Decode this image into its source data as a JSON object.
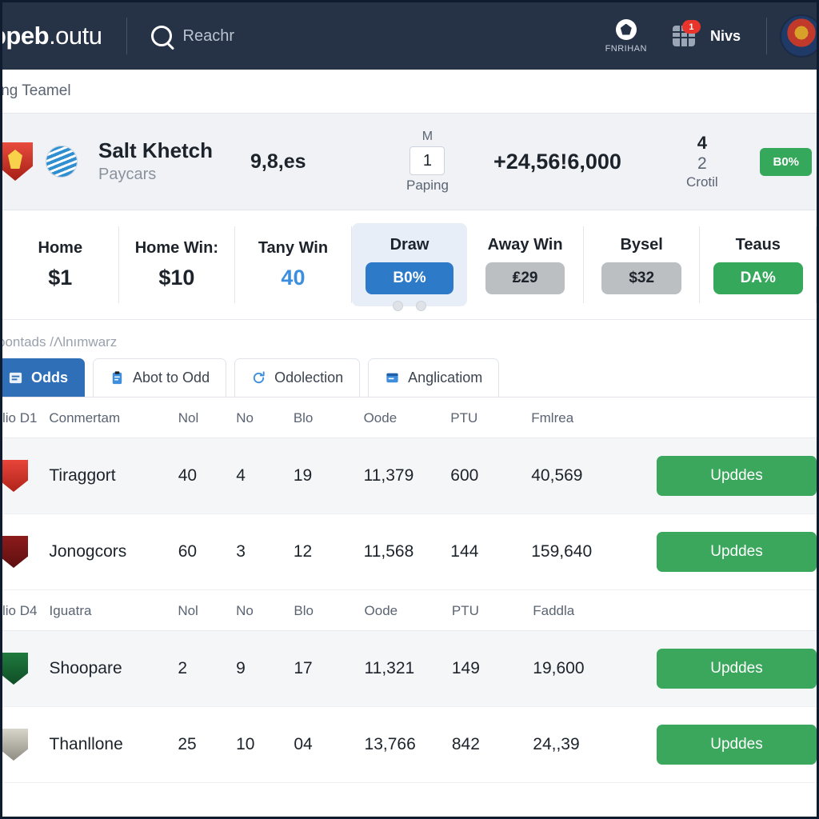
{
  "topnav": {
    "brand_bold": "ppeb",
    "brand_light": ".outu",
    "search_placeholder": "Reachr",
    "search_icon": "search-icon",
    "ball_icon": "soccer-ball-icon",
    "ball_label": "FNRIHAN",
    "grid_icon": "grid-icon",
    "grid_badge": "1",
    "notifications_label": "Nivs",
    "avatar": "user-avatar"
  },
  "breadcrumb": {
    "text": "ing Teamel"
  },
  "match_header": {
    "crest_icon": "team-crest-icon",
    "globe_icon": "globe-icon",
    "team_name": "Salt Khetch",
    "team_sub": "Paycars",
    "score": "9,8,es",
    "group_top": "M",
    "group_box": "1",
    "group_bottom": "Paping",
    "big_value": "+24,56!6,000",
    "stack_top": "4",
    "stack_mid": "2",
    "stack_bottom": "Crotil",
    "badge": "B0%",
    "badge_color": "#35a85b"
  },
  "odds": {
    "cells": [
      {
        "label": "Home",
        "value": "$1",
        "style": "text"
      },
      {
        "label": "Home Win:",
        "value": "$10",
        "style": "text"
      },
      {
        "label": "Tany Win",
        "value": "40",
        "style": "text-blue"
      },
      {
        "label": "Draw",
        "value": "B0%",
        "style": "pill-blue"
      },
      {
        "label": "Away Win",
        "value": "₤29",
        "style": "pill-gray"
      },
      {
        "label": "Bysel",
        "value": "$32",
        "style": "pill-gray"
      },
      {
        "label": "Teaus",
        "value": "DA%",
        "style": "pill-green"
      }
    ],
    "dots": 2,
    "accent_blue": "#2d7bc8",
    "accent_green": "#35a85b"
  },
  "section": {
    "label": "pontads /Λlnımwarz"
  },
  "tabs": [
    {
      "label": "Odds",
      "icon": "odds-icon",
      "active": true
    },
    {
      "label": "Abot to Odd",
      "icon": "clipboard-icon",
      "active": false
    },
    {
      "label": "Odolection",
      "icon": "refresh-icon",
      "active": false
    },
    {
      "label": "Anglicatiom",
      "icon": "window-icon",
      "active": false
    }
  ],
  "table": {
    "group1": {
      "headers": [
        "lio D1",
        "Conmertam",
        "Nol",
        "No",
        "Blo",
        "Oode",
        "PTU",
        "Fmlrea",
        ""
      ],
      "rows": [
        {
          "crest": "crest-red",
          "name": "Tiraggort",
          "c1": "40",
          "c2": "4",
          "c3": "19",
          "c4": "11,379",
          "c5": "600",
          "c6": "40,569",
          "action": "Upddes"
        },
        {
          "crest": "crest-maroon",
          "name": "Jonogcors",
          "c1": "60",
          "c2": "3",
          "c3": "12",
          "c4": "11,568",
          "c5": "144",
          "c6": "159,640",
          "action": "Upddes"
        }
      ]
    },
    "group2": {
      "headers": [
        "lio D4",
        "Iguatra",
        "Nol",
        "No",
        "Blo",
        "Oode",
        "PTU",
        "Faddla",
        ""
      ],
      "rows": [
        {
          "crest": "crest-green",
          "name": "Shoopare",
          "c1": "2",
          "c2": "9",
          "c3": "17",
          "c4": "11,321",
          "c5": "149",
          "c6": "19,600",
          "action": "Upddes"
        },
        {
          "crest": "crest-gray",
          "name": "Thanllone",
          "c1": "25",
          "c2": "10",
          "c3": "04",
          "c4": "13,766",
          "c5": "842",
          "c6": "24,,39",
          "action": "Upddes"
        }
      ]
    },
    "action_color": "#3aa75d"
  }
}
